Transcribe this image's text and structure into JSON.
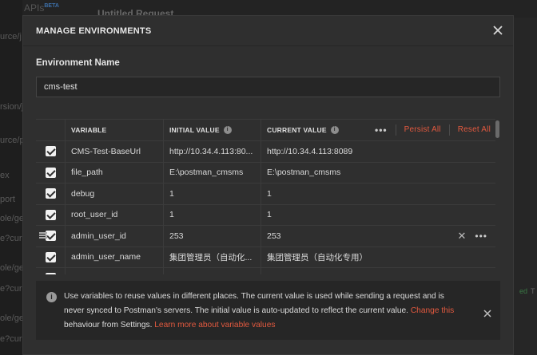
{
  "background": {
    "app_label": "APIs",
    "app_badge": "BETA",
    "request_tab": "Untitled Request",
    "sidebar_fragments": [
      "urce/j",
      "rsion/j",
      "urce/p",
      "ex",
      "port",
      "ole/ge",
      "e?curre",
      "ole/ge",
      "e?curre",
      "ole/ge",
      "e?curre",
      "ole/ge",
      "e?curre"
    ],
    "right_fragments": [
      "ed",
      "T"
    ]
  },
  "modal": {
    "title": "MANAGE ENVIRONMENTS",
    "env_name_label": "Environment Name",
    "env_name_value": "cms-test",
    "table": {
      "headers": {
        "variable": "VARIABLE",
        "initial_value": "INITIAL VALUE",
        "current_value": "CURRENT VALUE"
      },
      "more_label": "•••",
      "persist_all": "Persist All",
      "reset_all": "Reset All",
      "rows": [
        {
          "checked": true,
          "variable": "CMS-Test-BaseUrl",
          "initial": "http://10.34.4.113:80...",
          "current": "http://10.34.4.113:8089"
        },
        {
          "checked": true,
          "variable": "file_path",
          "initial": "E:\\postman_cmsms",
          "current": "E:\\postman_cmsms"
        },
        {
          "checked": true,
          "variable": "debug",
          "initial": "1",
          "current": "1"
        },
        {
          "checked": true,
          "variable": "root_user_id",
          "initial": "1",
          "current": "1"
        },
        {
          "checked": true,
          "variable": "admin_user_id",
          "initial": "253",
          "current": "253",
          "hovered": true
        },
        {
          "checked": true,
          "variable": "admin_user_name",
          "initial": "集团管理员（自动化...",
          "current": "集团管理员（自动化专用）"
        }
      ],
      "row_delete": "✕",
      "row_more": "•••"
    },
    "banner": {
      "text": "Use variables to reuse values in different places. The current value is used while sending a request and is never synced to Postman's servers. The initial value is auto-updated to reflect the current value. ",
      "link_change": "Change this",
      "text_after": " behaviour from Settings. ",
      "link_learn": "Learn more about variable values"
    }
  },
  "colors": {
    "accent": "#e2593f",
    "modal_bg": "#2f2f2f",
    "checkbox": "#f2f2f2"
  },
  "icons": [
    "close-icon",
    "info-icon",
    "drag-handle-icon",
    "checkbox-icon",
    "more-icon",
    "delete-icon"
  ]
}
